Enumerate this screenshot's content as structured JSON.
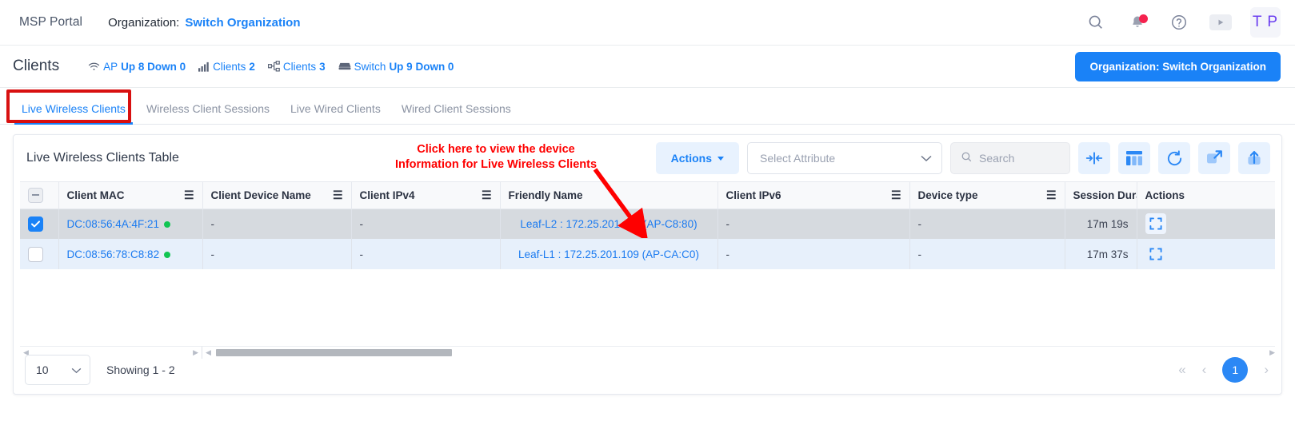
{
  "topbar": {
    "brand": "MSP Portal",
    "org_label": "Organization:",
    "org_link": "Switch Organization",
    "avatar_initials": "T P",
    "icons": {
      "search": "search-icon",
      "notifications": "bell-icon",
      "help": "help-circle-icon",
      "media": "play-icon"
    }
  },
  "subbar": {
    "page_title": "Clients",
    "stats": [
      {
        "icon": "wifi-icon",
        "name": "AP",
        "metrics": "Up 8 Down 0"
      },
      {
        "icon": "signal-icon",
        "name": "Clients",
        "metrics": "2"
      },
      {
        "icon": "network-icon",
        "name": "Clients",
        "metrics": "3"
      },
      {
        "icon": "switch-icon",
        "name": "Switch",
        "metrics": "Up 9 Down 0"
      }
    ],
    "org_button": "Organization: Switch Organization"
  },
  "tabs": [
    {
      "label": "Live Wireless Clients",
      "active": true
    },
    {
      "label": "Wireless Client Sessions",
      "active": false
    },
    {
      "label": "Live Wired Clients",
      "active": false
    },
    {
      "label": "Wired Client Sessions",
      "active": false
    }
  ],
  "annotation": {
    "line1": "Click here to view the device",
    "line2": "Information for Live Wireless Clients",
    "color": "#fe0000"
  },
  "card": {
    "title": "Live Wireless Clients Table",
    "actions_button": "Actions",
    "select_attribute_placeholder": "Select Attribute",
    "search_placeholder": "Search",
    "icon_buttons": [
      "fit-columns-icon",
      "columns-icon",
      "refresh-icon",
      "expand-icon",
      "export-upload-icon"
    ]
  },
  "table": {
    "columns": [
      {
        "label": "",
        "key": "select"
      },
      {
        "label": "Client MAC",
        "menu": true
      },
      {
        "label": "Client Device Name",
        "menu": true
      },
      {
        "label": "Client IPv4",
        "menu": true
      },
      {
        "label": "Friendly Name",
        "menu": false
      },
      {
        "label": "Client IPv6",
        "menu": true
      },
      {
        "label": "Device type",
        "menu": true
      },
      {
        "label": "Session Dura",
        "menu": false
      },
      {
        "label": "Actions",
        "menu": false
      }
    ],
    "rows": [
      {
        "selected": true,
        "client_mac": "DC:08:56:4A:4F:21",
        "status": "online",
        "client_device_name": "-",
        "client_ipv4": "-",
        "friendly_name": "Leaf-L2 : 172.25.201.113 (AP-C8:80)",
        "client_ipv6": "-",
        "device_type": "-",
        "session_duration": "17m 19s"
      },
      {
        "selected": false,
        "client_mac": "DC:08:56:78:C8:82",
        "status": "online",
        "client_device_name": "-",
        "client_ipv4": "-",
        "friendly_name": "Leaf-L1 : 172.25.201.109 (AP-CA:C0)",
        "client_ipv6": "-",
        "device_type": "-",
        "session_duration": "17m 37s"
      }
    ]
  },
  "footer": {
    "page_size": "10",
    "showing": "Showing 1 - 2",
    "first_page": "«",
    "prev_page": "‹",
    "current_page": "1",
    "next_page": "›"
  },
  "colors": {
    "accent": "#1a82f7",
    "annotation": "#fe0000",
    "status_online": "#12c552",
    "badge": "#f5224e"
  }
}
